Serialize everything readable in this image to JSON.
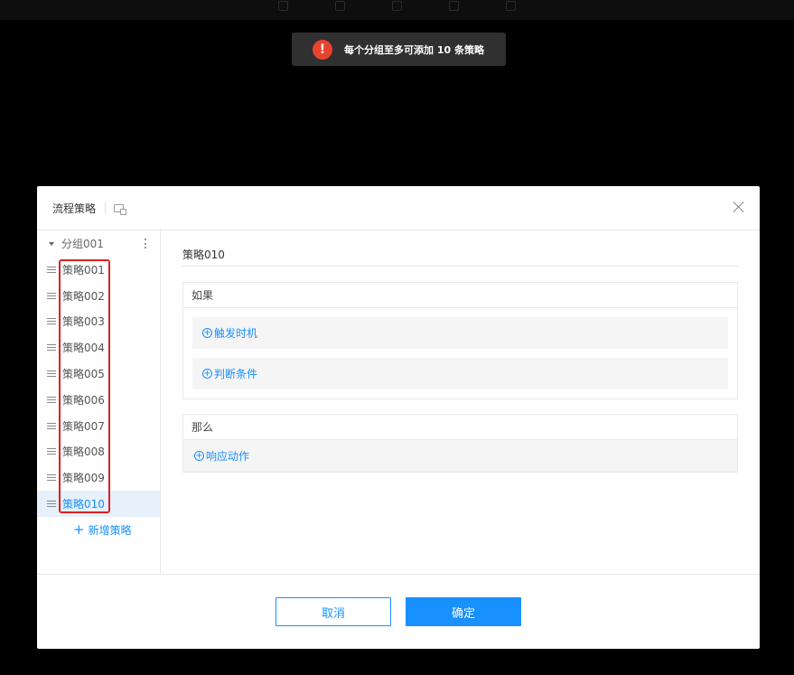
{
  "toast": {
    "icon": "exclamation-icon",
    "message": "每个分组至多可添加 10 条策略",
    "color": "#e8432f"
  },
  "modal": {
    "title": "流程策略",
    "close_icon": "close-icon"
  },
  "sidebar": {
    "group_label": "分组001",
    "items": [
      {
        "label": "策略001"
      },
      {
        "label": "策略002"
      },
      {
        "label": "策略003"
      },
      {
        "label": "策略004"
      },
      {
        "label": "策略005"
      },
      {
        "label": "策略006"
      },
      {
        "label": "策略007"
      },
      {
        "label": "策略008"
      },
      {
        "label": "策略009"
      },
      {
        "label": "策略010"
      }
    ],
    "active_index": 9,
    "add_label": "新增策略"
  },
  "content": {
    "title": "策略010",
    "if_section": {
      "title": "如果",
      "trigger_label": "触发时机",
      "condition_label": "判断条件"
    },
    "then_section": {
      "title": "那么",
      "action_label": "响应动作"
    }
  },
  "footer": {
    "cancel_label": "取消",
    "ok_label": "确定"
  },
  "colors": {
    "accent": "#1890ff",
    "highlight_box": "#e02020"
  }
}
